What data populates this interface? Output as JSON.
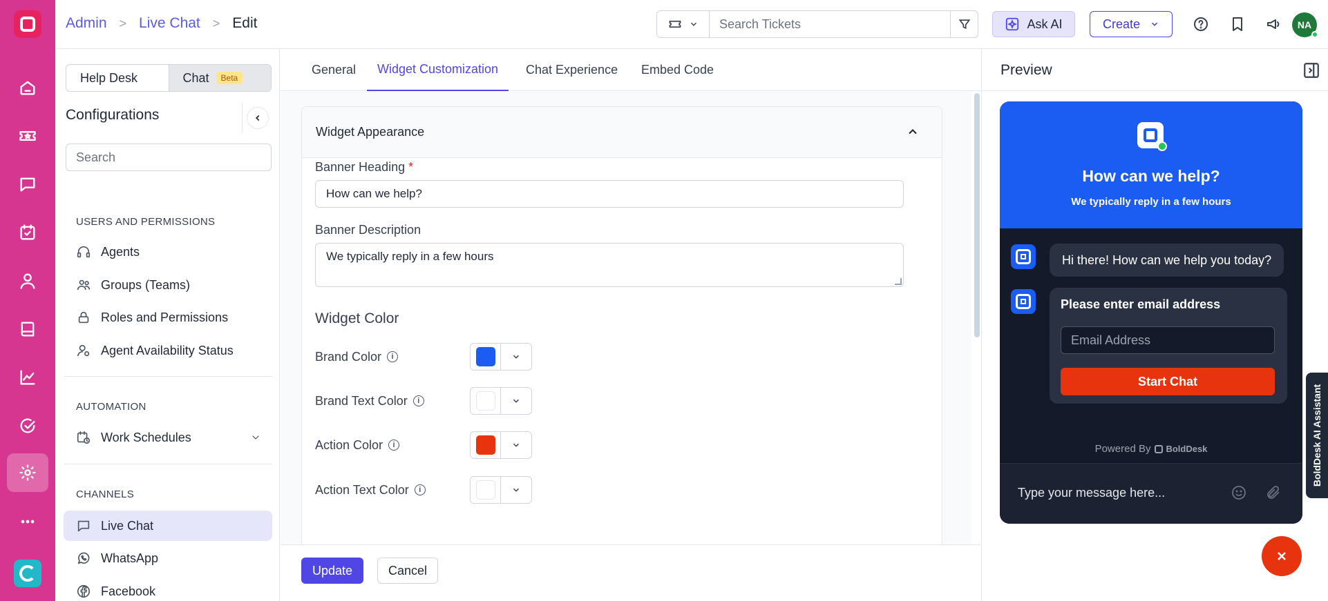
{
  "colors": {
    "rail": "#d6368f",
    "accent": "#4f46e5",
    "brand": "#1b5cf2",
    "action": "#e8340e",
    "widget_bg": "#141a29"
  },
  "rail": {
    "items": [
      {
        "name": "home-icon"
      },
      {
        "name": "ticket-icon"
      },
      {
        "name": "chat-icon"
      },
      {
        "name": "tasks-icon"
      },
      {
        "name": "contacts-icon"
      },
      {
        "name": "knowledge-base-icon"
      },
      {
        "name": "reports-icon"
      },
      {
        "name": "approvals-icon"
      },
      {
        "name": "settings-icon"
      },
      {
        "name": "more-icon"
      }
    ]
  },
  "header": {
    "breadcrumb": {
      "item1": "Admin",
      "item2": "Live Chat",
      "current": "Edit",
      "separator": ">"
    },
    "search_placeholder": "Search Tickets",
    "ask_ai": "Ask AI",
    "create": "Create",
    "avatar": "NA"
  },
  "sidebar": {
    "segment": {
      "helpdesk": "Help Desk",
      "chat": "Chat",
      "beta": "Beta"
    },
    "title": "Configurations",
    "search_placeholder": "Search",
    "section_users": "USERS AND PERMISSIONS",
    "users_items": [
      "Agents",
      "Groups (Teams)",
      "Roles and Permissions",
      "Agent Availability Status"
    ],
    "section_automation": "AUTOMATION",
    "automation_items": [
      "Work Schedules"
    ],
    "section_channels": "CHANNELS",
    "channel_items": [
      "Live Chat",
      "WhatsApp",
      "Facebook"
    ]
  },
  "tabs": [
    "General",
    "Widget Customization",
    "Chat Experience",
    "Embed Code"
  ],
  "form": {
    "section_title": "Widget Appearance",
    "banner_heading_label": "Banner Heading",
    "banner_heading_required": "*",
    "banner_heading_value": "How can we help?",
    "banner_description_label": "Banner Description",
    "banner_description_value": "We typically reply in a few hours",
    "widget_color_title": "Widget Color",
    "colors": [
      {
        "label": "Brand Color",
        "value": "#1b5cf2"
      },
      {
        "label": "Brand Text Color",
        "value": "#ffffff"
      },
      {
        "label": "Action Color",
        "value": "#e8340e"
      },
      {
        "label": "Action Text Color",
        "value": "#ffffff"
      }
    ]
  },
  "footer": {
    "update": "Update",
    "cancel": "Cancel"
  },
  "preview": {
    "title": "Preview",
    "heading": "How can we help?",
    "description": "We typically reply in a few hours",
    "greeting": "Hi there! How can we help you today?",
    "email_prompt": "Please enter email address",
    "email_placeholder": "Email Address",
    "start_chat": "Start Chat",
    "powered_by": "Powered By",
    "powered_brand": "BoldDesk",
    "compose_placeholder": "Type your message here..."
  },
  "ai_assistant": "BoldDesk AI Assistant"
}
